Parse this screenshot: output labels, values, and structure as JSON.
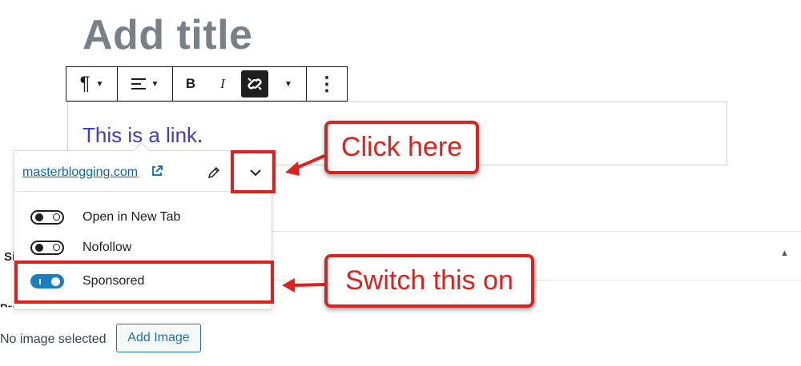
{
  "editor": {
    "title_placeholder": "Add title",
    "paragraph": {
      "link_text": "This is a link",
      "trailing_text": "."
    }
  },
  "toolbar": {
    "buttons": [
      "paragraph-icon",
      "align-icon",
      "bold",
      "italic",
      "link-active",
      "more-rich-text",
      "more-options"
    ],
    "bold_label": "B",
    "italic_label": "I",
    "paragraph_glyph": "¶",
    "more_glyph": "⋮"
  },
  "link_popover": {
    "url": "masterblogging.com",
    "settings": [
      {
        "label": "Open in New Tab",
        "enabled": false
      },
      {
        "label": "Nofollow",
        "enabled": false
      },
      {
        "label": "Sponsored",
        "enabled": true
      }
    ]
  },
  "sidebar_panel": {
    "section_label": "Si",
    "product_logo_label": "Product Logo",
    "no_image_text": "No image selected",
    "add_image_label": "Add Image"
  },
  "annotations": {
    "click_here": "Click here",
    "switch_this_on": "Switch this on",
    "color": "#e0201c"
  },
  "colors": {
    "link": "#3d3dc8",
    "url_link": "#0a66b8",
    "toggle_on": "#1a7fc0",
    "title_placeholder": "#7a8087"
  }
}
